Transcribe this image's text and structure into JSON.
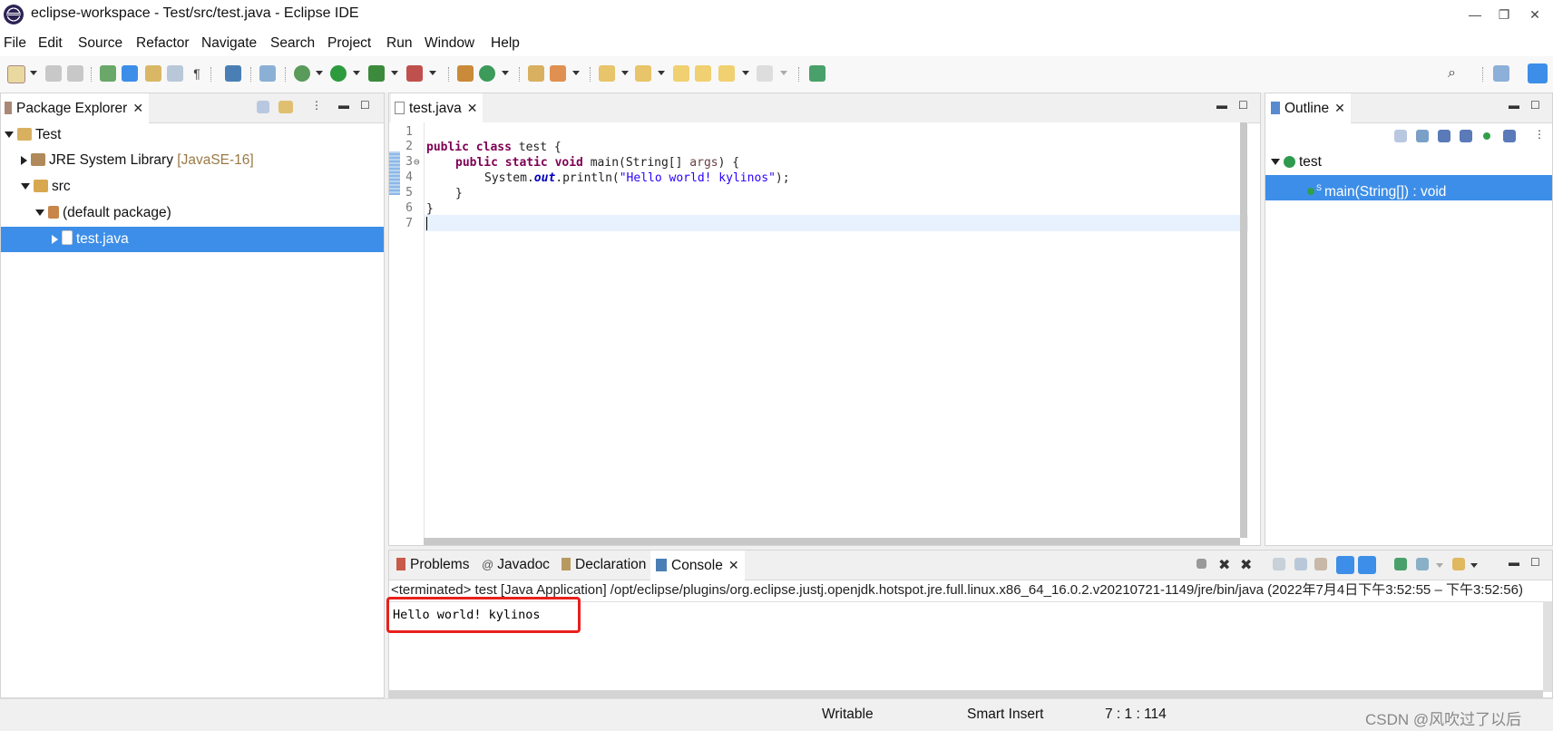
{
  "window": {
    "title": "eclipse-workspace - Test/src/test.java - Eclipse IDE",
    "minimize_glyph": "—",
    "restore_glyph": "❐",
    "close_glyph": "✕"
  },
  "menu": [
    "File",
    "Edit",
    "Source",
    "Refactor",
    "Navigate",
    "Search",
    "Project",
    "Run",
    "Window",
    "Help"
  ],
  "package_explorer": {
    "tab_label": "Package Explorer",
    "tree": {
      "project": "Test",
      "jre_label": "JRE System Library",
      "jre_version": "[JavaSE-16]",
      "src": "src",
      "package": "(default package)",
      "file": "test.java"
    }
  },
  "editor": {
    "tab_label": "test.java",
    "line_numbers": [
      "1",
      "2",
      "3",
      "4",
      "5",
      "6",
      "7"
    ],
    "fold_marker": "⊖",
    "code": {
      "l2_kw": "public class",
      "l2_rest": " test {",
      "l3_kw": "public static void",
      "l3_mid": " main(String[] ",
      "l3_param": "args",
      "l3_end": ") {",
      "l4_pre": "System.",
      "l4_field": "out",
      "l4_mid": ".println(",
      "l4_str": "\"Hello world! kylinos\"",
      "l4_end": ");",
      "l5": "}",
      "l6": "}"
    }
  },
  "outline": {
    "tab_label": "Outline",
    "class_name": "test",
    "method": "main(String[]) : void",
    "method_badge": "S"
  },
  "bottom_tabs": {
    "problems": "Problems",
    "javadoc": "Javadoc",
    "declaration": "Declaration",
    "console": "Console"
  },
  "console": {
    "header": "<terminated> test [Java Application] /opt/eclipse/plugins/org.eclipse.justj.openjdk.hotspot.jre.full.linux.x86_64_16.0.2.v20210721-1149/jre/bin/java  (2022年7月4日下午3:52:55 – 下午3:52:56)",
    "output": "Hello world! kylinos",
    "highlight_color": "#e8201c"
  },
  "status_bar": {
    "writable": "Writable",
    "insert_mode": "Smart Insert",
    "position": "7 : 1 : 114",
    "watermark": "CSDN @风吹过了以后"
  },
  "colors": {
    "selection": "#3d8ee8",
    "current_line": "#e8f2fe",
    "keyword": "#7f0055",
    "string": "#2a00ff"
  }
}
